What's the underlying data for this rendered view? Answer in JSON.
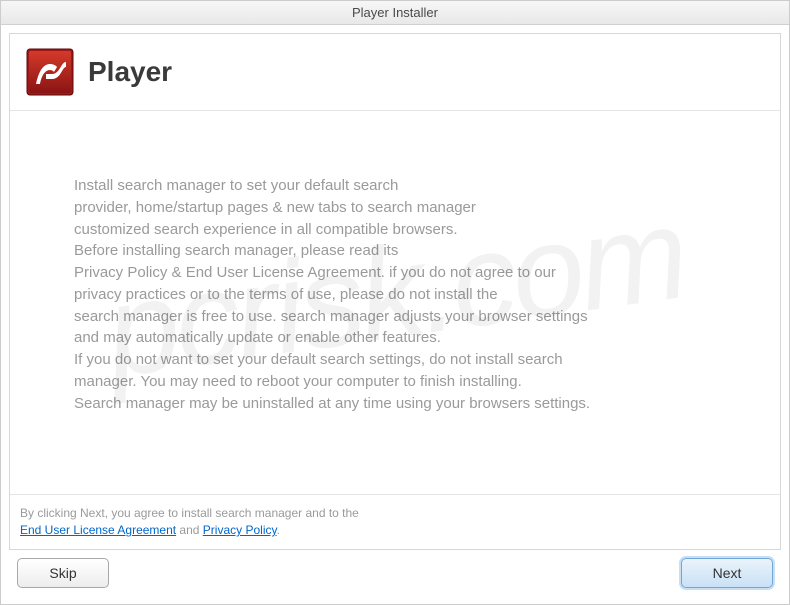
{
  "window": {
    "title": "Player Installer"
  },
  "header": {
    "title": "Player",
    "icon_name": "flash-player-icon"
  },
  "body": {
    "text": "Install search manager to set your default search\nprovider, home/startup pages & new tabs to search manager\ncustomized search experience in all compatible browsers.\nBefore installing search manager, please read its\nPrivacy Policy & End User License Agreement. if you do not agree to our\nprivacy practices or to the terms of use, please do not install the\nsearch manager is free to use. search manager adjusts your browser settings\nand may automatically update or enable other features.\nIf you do not want to set your default search settings, do not install search\nmanager. You may need to reboot your computer to finish installing.\nSearch manager may be uninstalled at any time using your browsers settings."
  },
  "footer": {
    "prefix": "By clicking Next, you agree to install search manager and to the",
    "eula_link": "End User License Agreement",
    "and": " and ",
    "privacy_link": "Privacy Policy",
    "suffix": "."
  },
  "buttons": {
    "skip": "Skip",
    "next": "Next"
  },
  "watermark": "pcrisk.com"
}
